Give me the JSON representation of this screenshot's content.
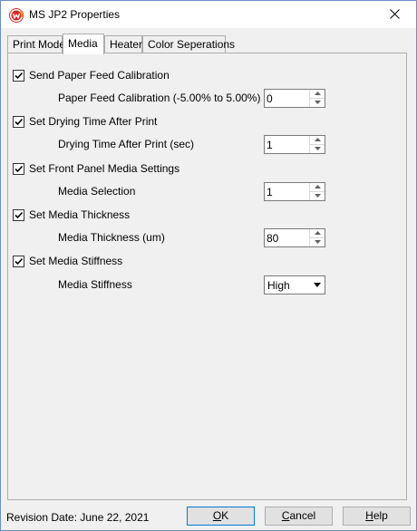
{
  "window": {
    "title": "MS JP2 Properties"
  },
  "tabs": [
    {
      "label": "Print Mode",
      "active": false
    },
    {
      "label": "Media",
      "active": true
    },
    {
      "label": "Heater",
      "active": false
    },
    {
      "label": "Color Seperations",
      "active": false
    }
  ],
  "settings": [
    {
      "checkbox_label": "Send Paper Feed Calibration",
      "checked": true,
      "field_label": "Paper Feed Calibration (-5.00% to 5.00%)",
      "control": "spin",
      "value": "0"
    },
    {
      "checkbox_label": "Set Drying Time After Print",
      "checked": true,
      "field_label": "Drying Time After Print (sec)",
      "control": "spin",
      "value": "1"
    },
    {
      "checkbox_label": "Set Front Panel Media Settings",
      "checked": true,
      "field_label": "Media Selection",
      "control": "spin",
      "value": "1"
    },
    {
      "checkbox_label": "Set Media Thickness",
      "checked": true,
      "field_label": "Media Thickness (um)",
      "control": "spin",
      "value": "80"
    },
    {
      "checkbox_label": "Set Media Stiffness",
      "checked": true,
      "field_label": "Media Stiffness",
      "control": "select",
      "value": "High"
    }
  ],
  "footer": {
    "revision": "Revision Date: June 22, 2021",
    "ok": {
      "accel": "O",
      "rest": "K"
    },
    "cancel": {
      "accel": "C",
      "rest": "ancel"
    },
    "help": {
      "accel": "H",
      "rest": "elp"
    }
  },
  "colors": {
    "accent": "#0078d7",
    "icon_red": "#d62728",
    "icon_orange": "#f2a900"
  }
}
